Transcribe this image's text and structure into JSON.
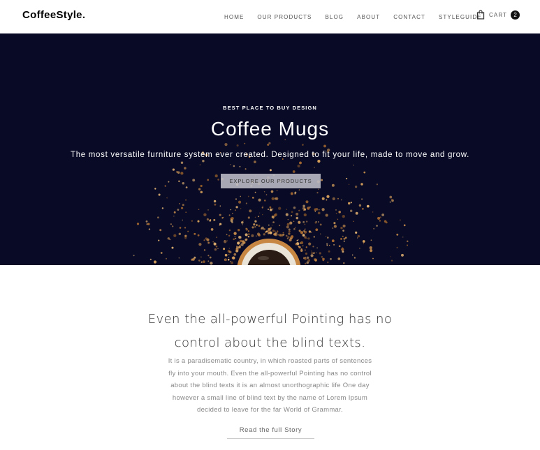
{
  "header": {
    "logo": "CoffeeStyle.",
    "nav": [
      "HOME",
      "OUR PRODUCTS",
      "BLOG",
      "ABOUT",
      "CONTACT",
      "STYLEGUIDE"
    ],
    "cart_label": "CART",
    "cart_count": "2",
    "cart_icon": "shopping-bag-icon"
  },
  "hero": {
    "kicker": "BEST PLACE TO BUY DESIGN",
    "title": "Coffee Mugs",
    "subtitle": "The most versatile furniture system ever created. Designed to fit your life, made to move and grow.",
    "button_label": "EXPLORE OUR PRODUCTS",
    "background_color": "#080a26"
  },
  "story": {
    "heading_line1": "Even the all-powerful Pointing has no",
    "heading_line2": "control about the blind texts.",
    "body_lines": [
      "It is a paradisematic country, in which roasted parts of sentences",
      "fly into your mouth. Even the all-powerful Pointing has no control",
      "about the blind texts it is an almost unorthographic life One day",
      "however a small line of blind text by the name of Lorem Ipsum",
      "decided to leave for the far World of Grammar."
    ],
    "link_label": "Read the full Story"
  }
}
